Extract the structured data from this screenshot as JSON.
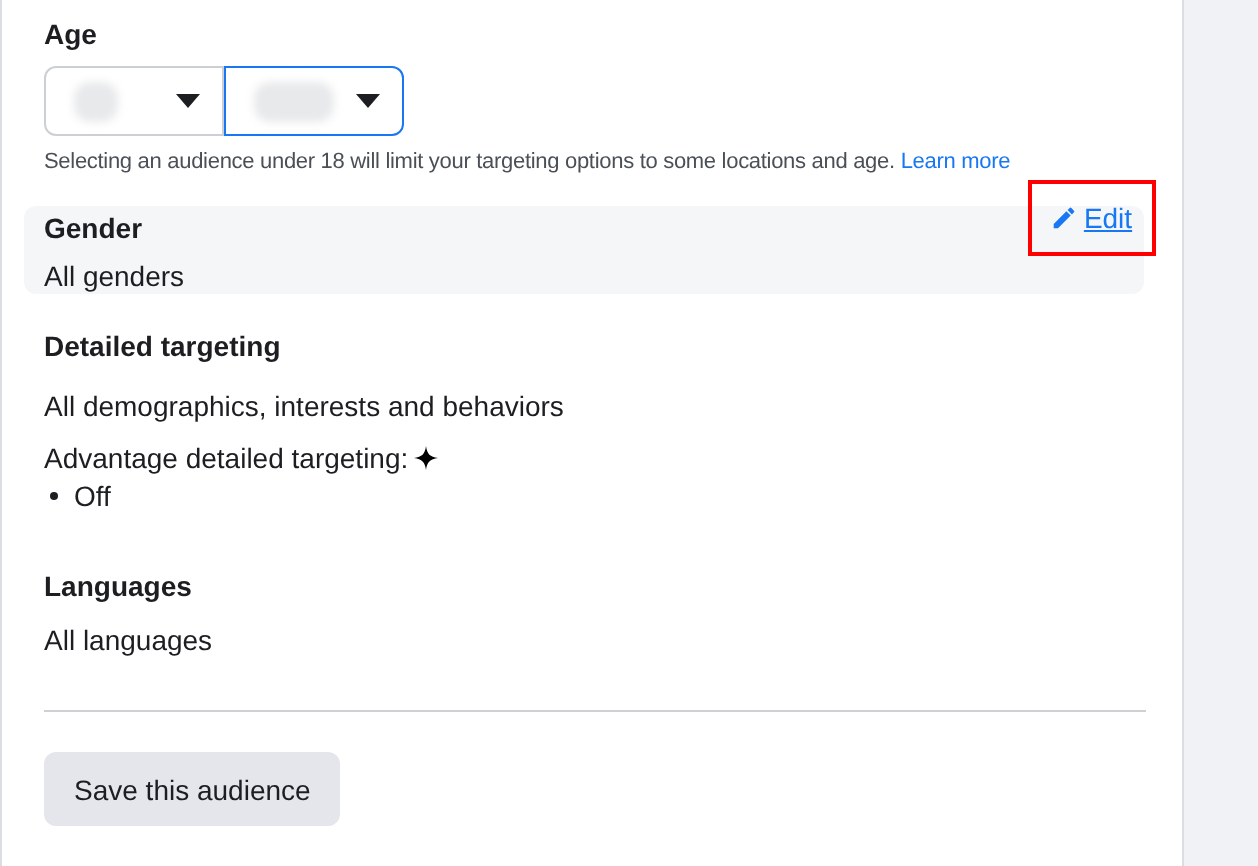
{
  "age": {
    "label": "Age",
    "dropdowns": [
      {
        "selected": false
      },
      {
        "selected": true
      }
    ],
    "note": "Selecting an audience under 18 will limit your targeting options to some locations and age.",
    "note_link": "Learn more"
  },
  "gender": {
    "label": "Gender",
    "value": "All genders",
    "edit": "Edit",
    "highlighted": true
  },
  "detailed_targeting": {
    "label": "Detailed targeting",
    "value": "All demographics, interests and behaviors",
    "advantage_label": "Advantage detailed targeting:",
    "advantage_items": [
      "Off"
    ]
  },
  "languages": {
    "label": "Languages",
    "value": "All languages"
  },
  "save_button": "Save this audience"
}
